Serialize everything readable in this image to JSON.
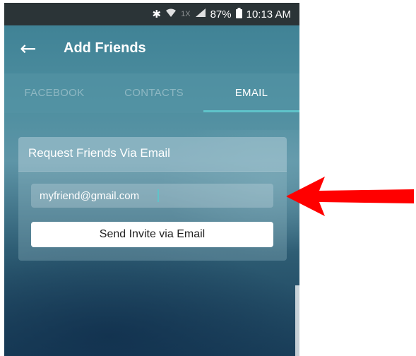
{
  "status_bar": {
    "bluetooth_icon": "✱",
    "wifi_icon": "wifi-icon",
    "network_label": "1X",
    "battery_level": "87%",
    "time": "10:13 AM"
  },
  "app_bar": {
    "back_icon": "←",
    "title": "Add Friends"
  },
  "tabs": [
    {
      "label": "FACEBOOK",
      "active": false
    },
    {
      "label": "CONTACTS",
      "active": false
    },
    {
      "label": "EMAIL",
      "active": true
    }
  ],
  "card": {
    "title": "Request Friends Via Email",
    "email_value": "myfriend@gmail.com",
    "send_label": "Send Invite via Email"
  },
  "annotation": {
    "arrow_color": "#ff0000"
  },
  "colors": {
    "accent": "#5fc3c9",
    "status_bar_bg": "#2b3437"
  }
}
